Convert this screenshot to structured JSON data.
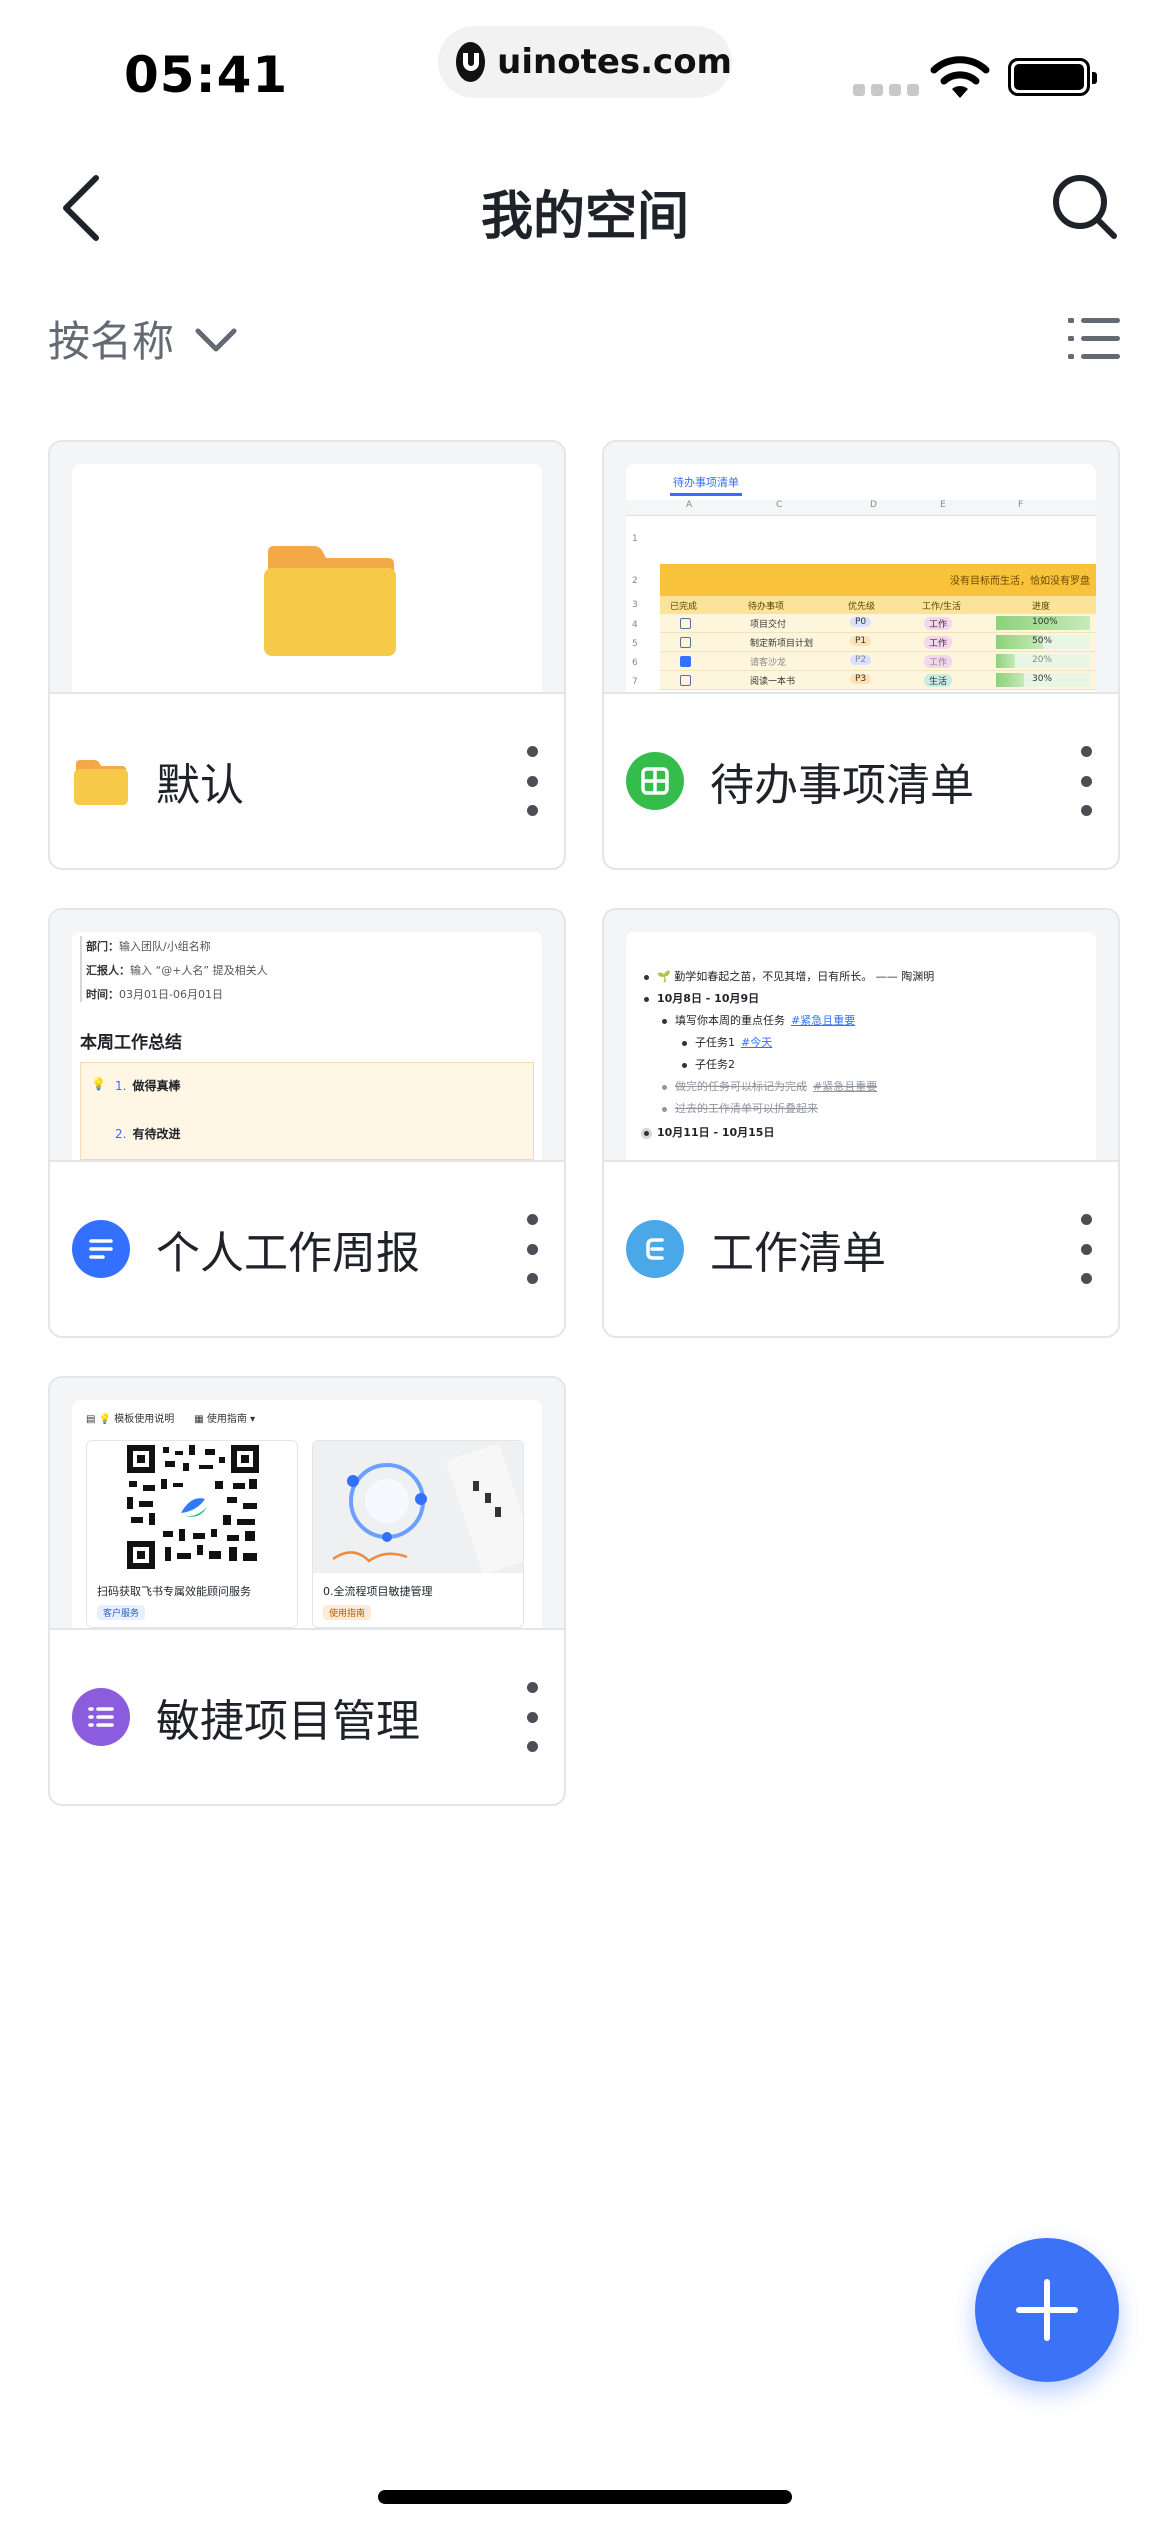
{
  "status_bar": {
    "time": "05:41",
    "watermark": "uinotes.com"
  },
  "nav": {
    "title": "我的空间"
  },
  "toolbar": {
    "sort_label": "按名称"
  },
  "items": [
    {
      "name": "默认",
      "type": "folder",
      "icon": "folder-icon",
      "color": "#f7c948"
    },
    {
      "name": "待办事项清单",
      "type": "sheet",
      "icon": "sheet-icon",
      "color": "#35bd4b"
    },
    {
      "name": "个人工作周报",
      "type": "doc",
      "icon": "doc-icon",
      "color": "#3370ff"
    },
    {
      "name": "工作清单",
      "type": "mindnote",
      "icon": "mindnote-icon",
      "color": "#4aa8e8"
    },
    {
      "name": "敏捷项目管理",
      "type": "bitable",
      "icon": "bitable-icon",
      "color": "#8c5cde"
    }
  ],
  "previews": {
    "sheet": {
      "tab": "待办事项清单",
      "banner": "没有目标而生活，恰如没有罗盘",
      "columns": [
        "已完成",
        "待办事项",
        "优先级",
        "工作/生活",
        "进度"
      ],
      "rows": [
        {
          "done": false,
          "task": "项目交付",
          "priority": "P0",
          "category": "工作",
          "progress": "100%",
          "progress_value": 1.0
        },
        {
          "done": false,
          "task": "制定新项目计划",
          "priority": "P1",
          "category": "工作",
          "progress": "50%",
          "progress_value": 0.5
        },
        {
          "done": true,
          "task": "请客沙龙",
          "priority": "P2",
          "category": "工作",
          "progress": "20%",
          "progress_value": 0.2
        },
        {
          "done": false,
          "task": "阅读一本书",
          "priority": "P3",
          "category": "生活",
          "progress": "30%",
          "progress_value": 0.3
        }
      ]
    },
    "doc": {
      "dept_label": "部门：",
      "dept_value": "输入团队/小组名称",
      "reporter_label": "汇报人：",
      "reporter_value": "输入 “@+人名” 提及相关人",
      "time_label": "时间：",
      "time_value": "03月01日-06月01日",
      "heading": "本周工作总结",
      "point1": "做得真棒",
      "point2": "有待改进"
    },
    "mindnote": {
      "quote": "勤学如春起之苗，不见其增，日有所长。 —— 陶渊明",
      "week1": "10月8日 - 10月9日",
      "task_fill": "填写你本周的重点任务",
      "task_fill_tag": "#紧急且重要",
      "sub1": "子任务1",
      "sub1_tag": "#今天",
      "sub2": "子任务2",
      "done_hint": "做完的任务可以标记为完成",
      "done_hint_tag": "#紧急且重要",
      "fold_hint": "过去的工作清单可以折叠起来",
      "week2": "10月11日 - 10月15日"
    },
    "bitable": {
      "view1": "模板使用说明",
      "view2": "使用指南",
      "card1_title": "扫码获取飞书专属效能顾问服务",
      "card1_tag": "客户服务",
      "card2_title": "0.全流程项目敏捷管理",
      "card2_tag": "使用指南"
    }
  }
}
